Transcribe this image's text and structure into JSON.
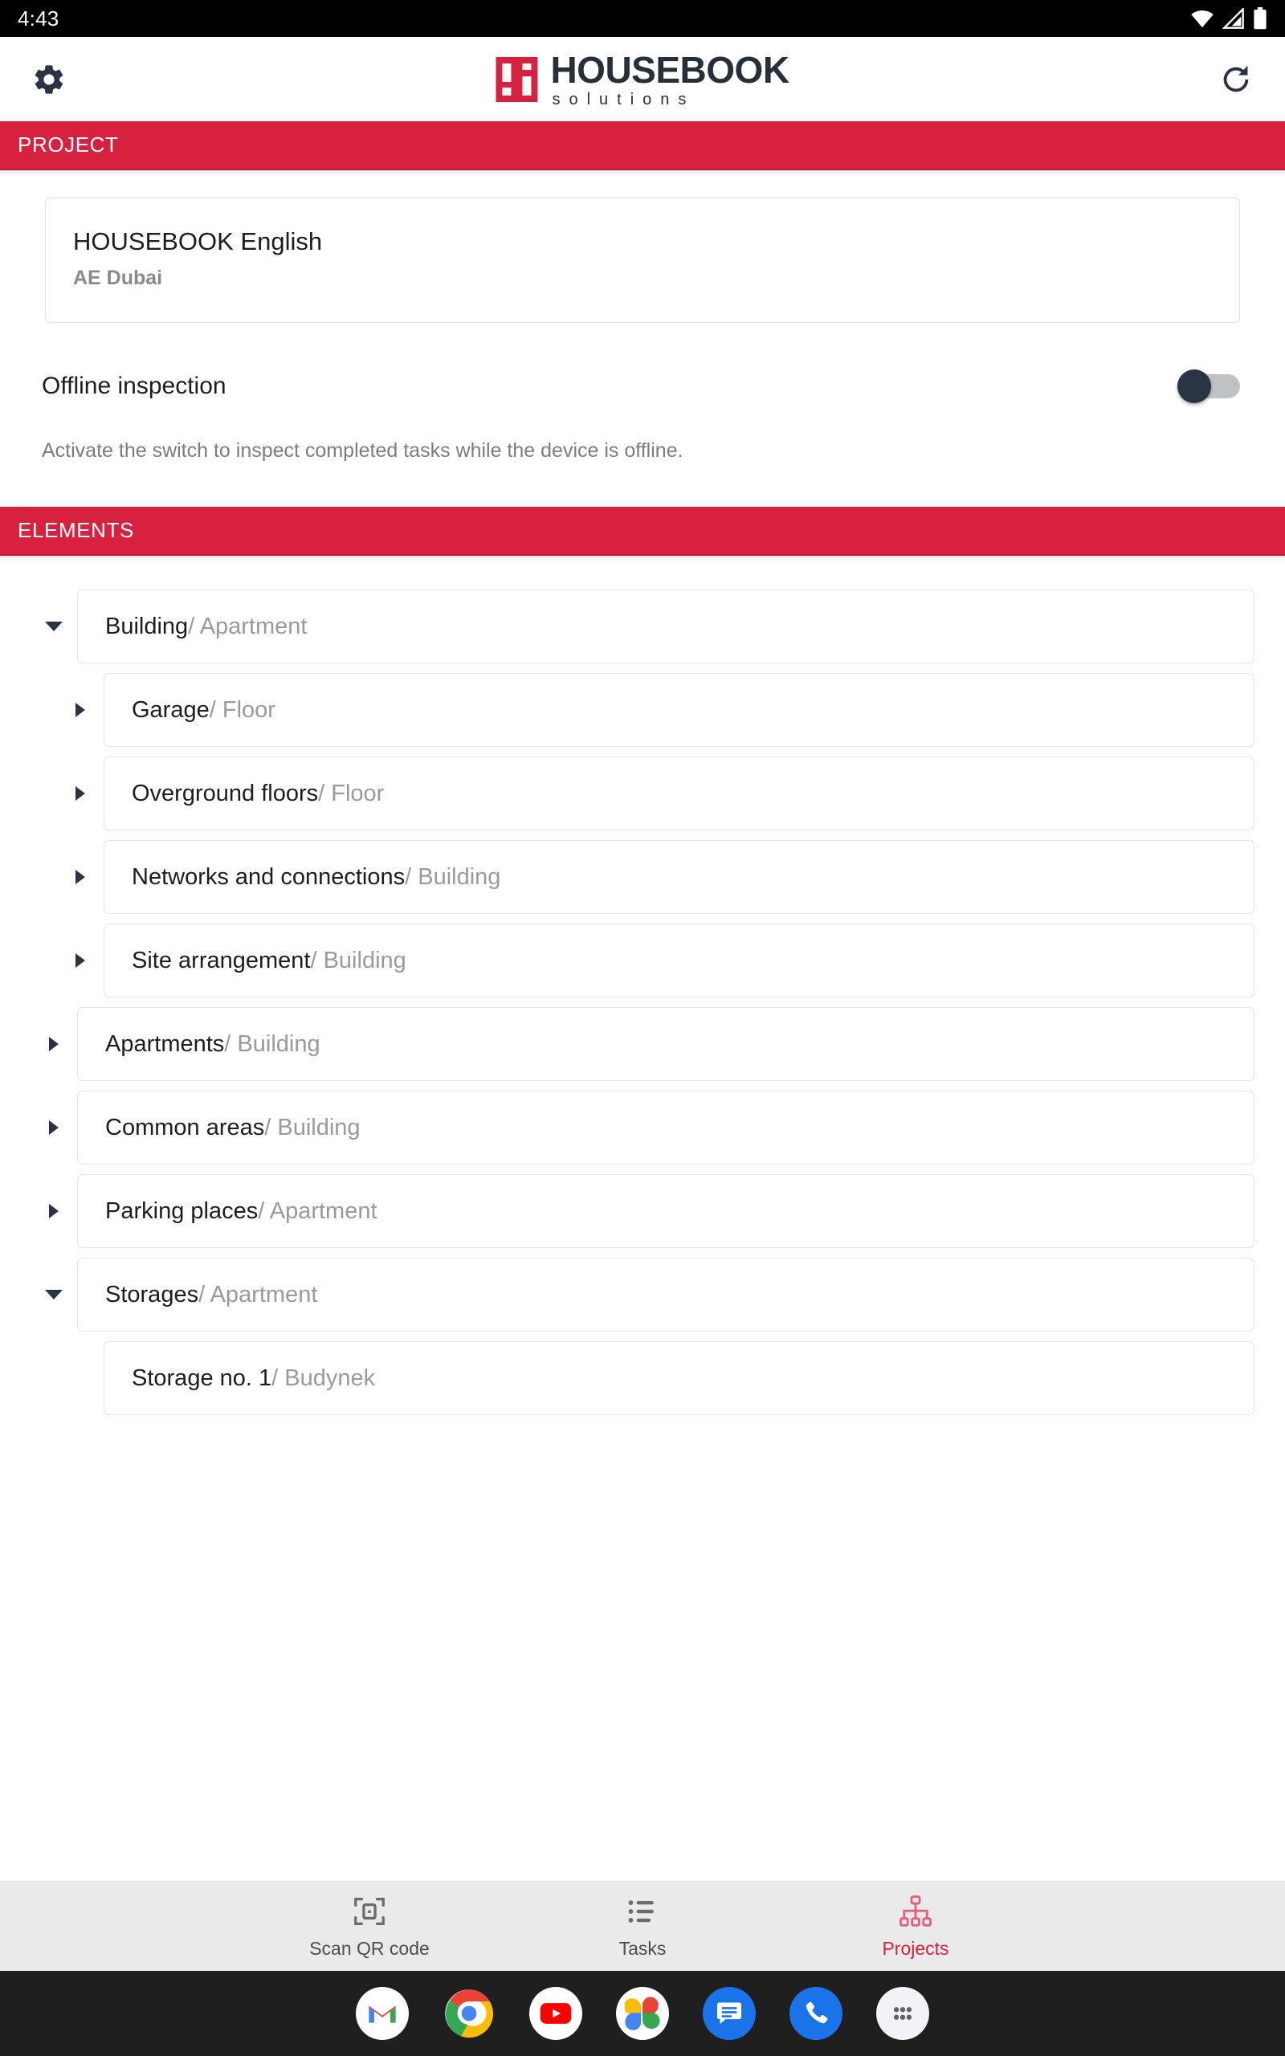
{
  "status_bar": {
    "time": "4:43",
    "icons": [
      "wifi-icon",
      "cellular-signal-icon",
      "battery-icon"
    ]
  },
  "header": {
    "settings_icon": "gear-icon",
    "refresh_icon": "refresh-icon",
    "logo_main": "HOUSEBOOK",
    "logo_sub": "solutions",
    "brand_red": "#d8203f",
    "brand_dark": "#272f3b"
  },
  "project_section": {
    "title": "PROJECT",
    "card": {
      "name": "HOUSEBOOK English",
      "location": "AE Dubai"
    },
    "offline": {
      "label": "Offline inspection",
      "enabled": false,
      "hint": "Activate the switch to inspect completed tasks while the device is offline."
    }
  },
  "elements_section": {
    "title": "ELEMENTS",
    "items": [
      {
        "name": "Building",
        "type": "Apartment",
        "depth": 0,
        "expandable": true,
        "expanded": true
      },
      {
        "name": "Garage",
        "type": "Floor",
        "depth": 1,
        "expandable": true,
        "expanded": false
      },
      {
        "name": "Overground floors",
        "type": "Floor",
        "depth": 1,
        "expandable": true,
        "expanded": false
      },
      {
        "name": "Networks and connections",
        "type": "Building",
        "depth": 1,
        "expandable": true,
        "expanded": false
      },
      {
        "name": "Site arrangement",
        "type": "Building",
        "depth": 1,
        "expandable": true,
        "expanded": false
      },
      {
        "name": "Apartments",
        "type": "Building",
        "depth": 0,
        "expandable": true,
        "expanded": false
      },
      {
        "name": "Common areas",
        "type": "Building",
        "depth": 0,
        "expandable": true,
        "expanded": false
      },
      {
        "name": "Parking places",
        "type": "Apartment",
        "depth": 0,
        "expandable": true,
        "expanded": false
      },
      {
        "name": "Storages",
        "type": "Apartment",
        "depth": 0,
        "expandable": true,
        "expanded": true
      },
      {
        "name": "Storage no. 1",
        "type": "Budynek",
        "depth": 1,
        "expandable": false,
        "expanded": false
      }
    ],
    "separator": "/"
  },
  "bottom_nav": {
    "items": [
      {
        "label": "Scan QR code",
        "icon": "qr-scan-icon",
        "active": false
      },
      {
        "label": "Tasks",
        "icon": "list-icon",
        "active": false
      },
      {
        "label": "Projects",
        "icon": "org-chart-icon",
        "active": true
      }
    ],
    "active_color": "#d8203f",
    "inactive_color": "#4d4d4d"
  },
  "android_dock": {
    "apps": [
      "gmail-icon",
      "chrome-icon",
      "youtube-icon",
      "google-photos-icon",
      "messages-icon",
      "phone-icon",
      "app-drawer-icon"
    ]
  }
}
